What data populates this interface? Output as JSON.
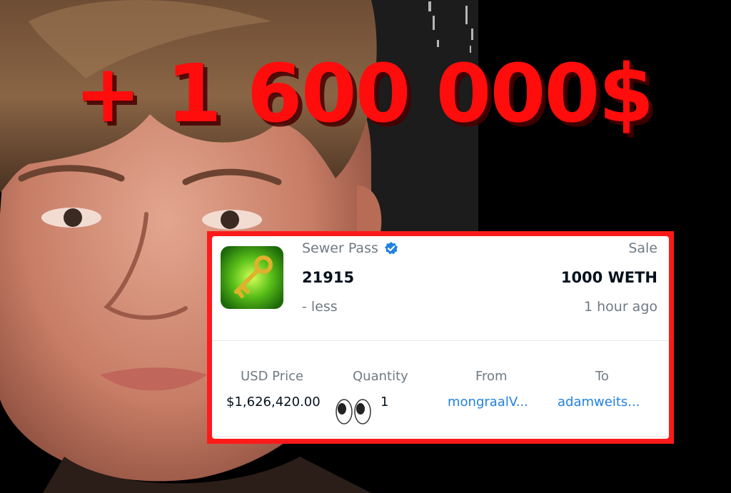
{
  "headline": "+ 1 600 000$",
  "card": {
    "collection_name": "Sewer Pass",
    "token_id": "21915",
    "sub_left": "- less",
    "event_type": "Sale",
    "price": "1000 WETH",
    "time_ago": "1 hour ago",
    "columns": [
      {
        "label": "USD Price",
        "value": "$1,626,420.00"
      },
      {
        "label": "Quantity",
        "value": "1"
      },
      {
        "label": "From",
        "value": "mongraalV..."
      },
      {
        "label": "To",
        "value": "adamweits..."
      }
    ]
  },
  "icons": {
    "verified": "verified-badge-icon",
    "eyes": "eyes-emoji-icon",
    "thumbnail": "golden-key-icon"
  },
  "colors": {
    "headline": "#ff0d0d",
    "frame": "#ff1a1a",
    "link": "#2081e2",
    "muted": "#707a83",
    "dark": "#04111d"
  }
}
